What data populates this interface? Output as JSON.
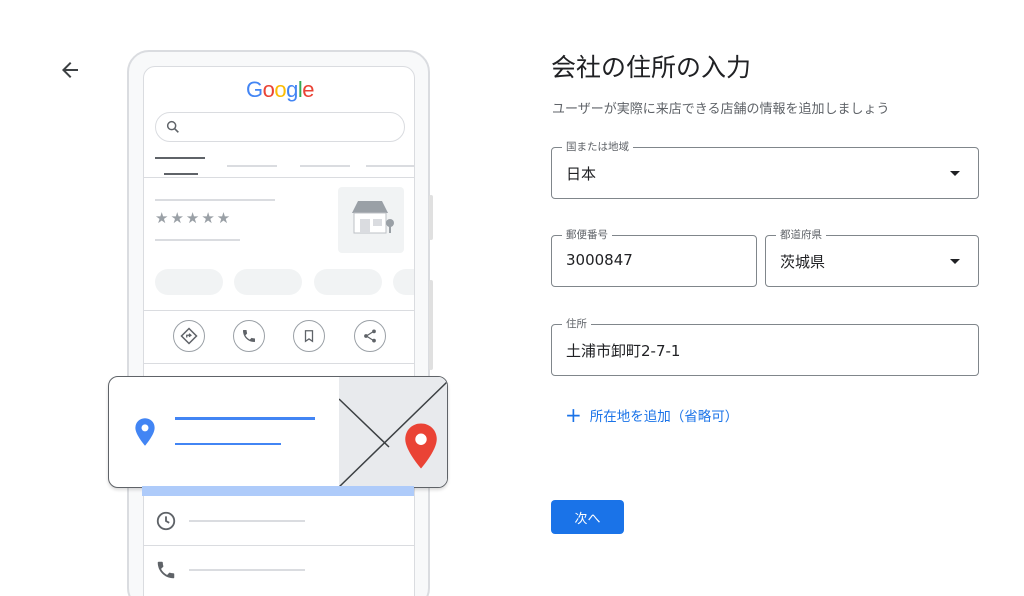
{
  "header": {
    "back_icon": "arrow-back-icon"
  },
  "illustration": {
    "logo_letters": [
      {
        "char": "G",
        "color": "#4285f4"
      },
      {
        "char": "o",
        "color": "#ea4335"
      },
      {
        "char": "o",
        "color": "#fbbc05"
      },
      {
        "char": "g",
        "color": "#4285f4"
      },
      {
        "char": "l",
        "color": "#34a853"
      },
      {
        "char": "e",
        "color": "#ea4335"
      }
    ],
    "rating_stars": "★★★★★",
    "icons": [
      "search-icon",
      "directions-icon",
      "phone-icon",
      "bookmark-icon",
      "share-icon",
      "location-pin-icon",
      "map-pin-icon",
      "clock-icon",
      "storefront-icon"
    ],
    "pin_colors": {
      "blue": "#4285f4",
      "red": "#ea4335"
    }
  },
  "form": {
    "title": "会社の住所の入力",
    "subtitle": "ユーザーが実際に来店できる店舗の情報を追加しましょう",
    "country": {
      "label": "国または地域",
      "value": "日本"
    },
    "postal_code": {
      "label": "郵便番号",
      "value": "3000847"
    },
    "prefecture": {
      "label": "都道府県",
      "value": "茨城県"
    },
    "address": {
      "label": "住所",
      "value": "土浦市卸町2-7-1"
    },
    "add_address_line": {
      "icon": "plus-icon",
      "label": "所在地を追加（省略可）"
    },
    "next_button": "次へ",
    "accent_color": "#1a73e8"
  }
}
